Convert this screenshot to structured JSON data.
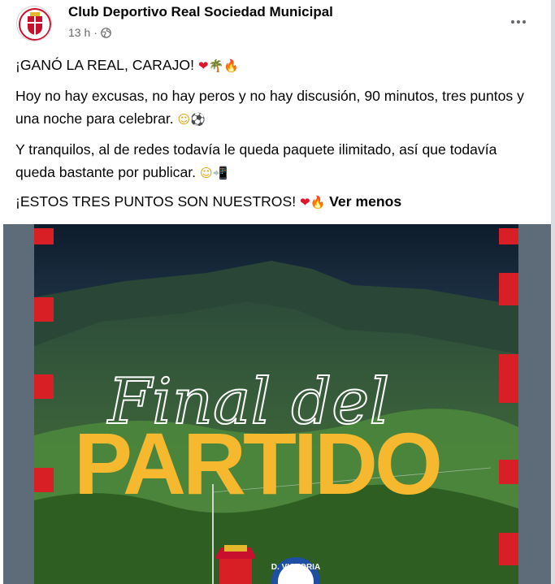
{
  "post": {
    "page_name": "Club Deportivo Real Sociedad Municipal",
    "time": "13 h",
    "privacy_icon": "globe-icon",
    "more_icon": "more-options-icon",
    "lines": {
      "l1": "¡GANÓ LA REAL, CARAJO!",
      "l2": "Hoy no hay excusas, no hay peros y no hay discusión, 90 minutos, tres puntos y una noche para celebrar.",
      "l3": "Y tranquilos, al de redes todavía le queda paquete ilimitado, así que todavía queda bastante por publicar.",
      "l4": "¡ESTOS TRES PUNTOS SON NUESTROS!"
    },
    "see_less": "Ver menos"
  },
  "image": {
    "title_script": "Final del",
    "title_block": "PARTIDO",
    "badge_right_text": "D. VICTORIA",
    "colors": {
      "title": "#f5b82e",
      "accent_red": "#d91f26",
      "accent_blue": "#1f4fa3"
    }
  }
}
